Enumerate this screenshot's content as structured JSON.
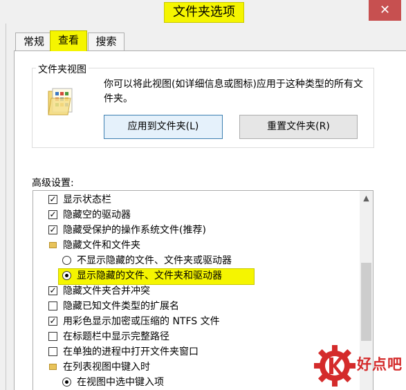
{
  "window": {
    "title": "文件夹选项",
    "close_glyph": "✕"
  },
  "tabs": [
    {
      "label": "常规",
      "selected": false
    },
    {
      "label": "查看",
      "selected": true
    },
    {
      "label": "搜索",
      "selected": false
    }
  ],
  "folder_views": {
    "title": "文件夹视图",
    "description": "你可以将此视图(如详细信息或图标)应用于这种类型的所有文件夹。",
    "apply_button": "应用到文件夹(L)",
    "reset_button": "重置文件夹(R)"
  },
  "advanced": {
    "label": "高级设置:",
    "items": [
      {
        "type": "checkbox",
        "checked": true,
        "label": "显示状态栏"
      },
      {
        "type": "checkbox",
        "checked": true,
        "label": "隐藏空的驱动器"
      },
      {
        "type": "checkbox",
        "checked": true,
        "label": "隐藏受保护的操作系统文件(推荐)"
      },
      {
        "type": "folder",
        "label": "隐藏文件和文件夹"
      },
      {
        "type": "radio",
        "checked": false,
        "label": "不显示隐藏的文件、文件夹或驱动器"
      },
      {
        "type": "radio",
        "checked": true,
        "label": "显示隐藏的文件、文件夹和驱动器"
      },
      {
        "type": "checkbox",
        "checked": true,
        "label": "隐藏文件夹合并冲突"
      },
      {
        "type": "checkbox",
        "checked": false,
        "label": "隐藏已知文件类型的扩展名"
      },
      {
        "type": "checkbox",
        "checked": true,
        "label": "用彩色显示加密或压缩的 NTFS 文件"
      },
      {
        "type": "checkbox",
        "checked": false,
        "label": "在标题栏中显示完整路径"
      },
      {
        "type": "checkbox",
        "checked": false,
        "label": "在单独的进程中打开文件夹窗口"
      },
      {
        "type": "folder",
        "label": "在列表视图中键入时"
      },
      {
        "type": "radio",
        "checked": true,
        "label": "在视图中选中键入项"
      }
    ]
  },
  "watermark": {
    "text": "好点吧"
  },
  "colors": {
    "highlight": "#f5f500",
    "close_button": "#c75050",
    "logo_red": "#d42b2b"
  }
}
